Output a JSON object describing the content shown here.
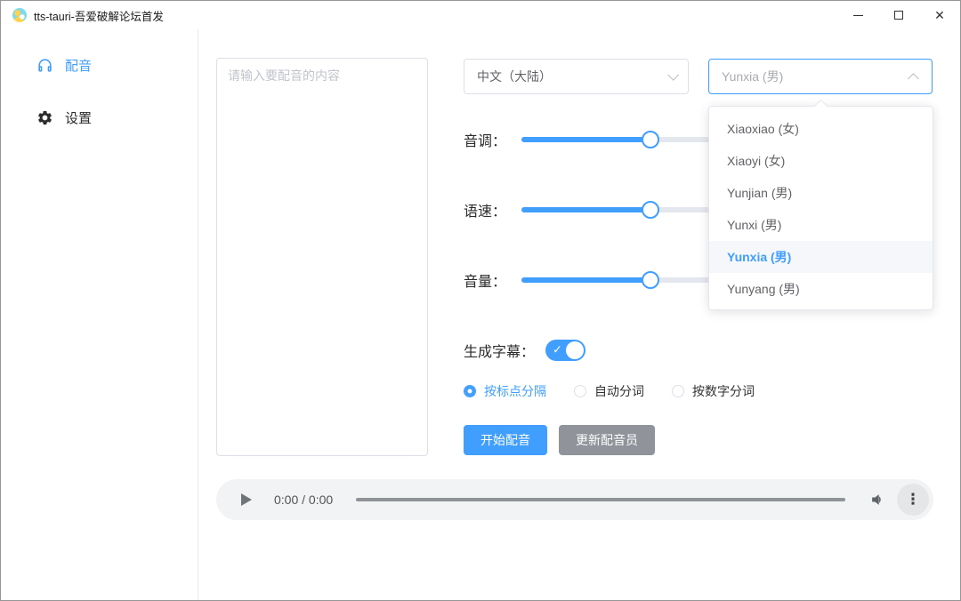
{
  "window": {
    "title": "tts-tauri-吾爱破解论坛首发"
  },
  "icons": {
    "check": "✓",
    "close": "✕",
    "kebab": "⋮"
  },
  "sidebar": {
    "items": [
      {
        "label": "配音",
        "icon": "headphones-icon",
        "active": true
      },
      {
        "label": "设置",
        "icon": "gear-icon",
        "active": false
      }
    ]
  },
  "editor": {
    "placeholder": "请输入要配音的内容",
    "value": ""
  },
  "voice_panel": {
    "language_select": {
      "value": "中文（大陆）"
    },
    "voice_select": {
      "value": "Yunxia (男)",
      "open": true
    },
    "voice_options": [
      {
        "label": "Xiaoxiao (女)",
        "selected": false
      },
      {
        "label": "Xiaoyi (女)",
        "selected": false
      },
      {
        "label": "Yunjian (男)",
        "selected": false
      },
      {
        "label": "Yunxi (男)",
        "selected": false
      },
      {
        "label": "Yunxia (男)",
        "selected": true
      },
      {
        "label": "Yunyang (男)",
        "selected": false
      }
    ],
    "sliders": [
      {
        "label": "音调：",
        "percent": 34
      },
      {
        "label": "语速：",
        "percent": 34
      },
      {
        "label": "音量：",
        "percent": 34
      }
    ],
    "subtitle_toggle": {
      "label": "生成字幕：",
      "on": true
    },
    "segmentation_options": [
      {
        "label": "按标点分隔",
        "selected": true
      },
      {
        "label": "自动分词",
        "selected": false
      },
      {
        "label": "按数字分词",
        "selected": false
      }
    ],
    "buttons": {
      "start": "开始配音",
      "update": "更新配音员"
    }
  },
  "audio_player": {
    "time": "0:00 / 0:00"
  },
  "colors": {
    "primary": "#409EFF",
    "gray_button": "#909399"
  }
}
